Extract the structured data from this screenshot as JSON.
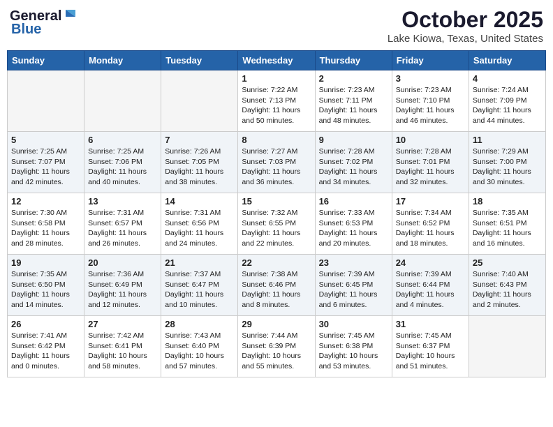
{
  "header": {
    "logo_general": "General",
    "logo_blue": "Blue",
    "month_title": "October 2025",
    "location": "Lake Kiowa, Texas, United States"
  },
  "days_of_week": [
    "Sunday",
    "Monday",
    "Tuesday",
    "Wednesday",
    "Thursday",
    "Friday",
    "Saturday"
  ],
  "weeks": [
    [
      {
        "day": "",
        "info": ""
      },
      {
        "day": "",
        "info": ""
      },
      {
        "day": "",
        "info": ""
      },
      {
        "day": "1",
        "info": "Sunrise: 7:22 AM\nSunset: 7:13 PM\nDaylight: 11 hours\nand 50 minutes."
      },
      {
        "day": "2",
        "info": "Sunrise: 7:23 AM\nSunset: 7:11 PM\nDaylight: 11 hours\nand 48 minutes."
      },
      {
        "day": "3",
        "info": "Sunrise: 7:23 AM\nSunset: 7:10 PM\nDaylight: 11 hours\nand 46 minutes."
      },
      {
        "day": "4",
        "info": "Sunrise: 7:24 AM\nSunset: 7:09 PM\nDaylight: 11 hours\nand 44 minutes."
      }
    ],
    [
      {
        "day": "5",
        "info": "Sunrise: 7:25 AM\nSunset: 7:07 PM\nDaylight: 11 hours\nand 42 minutes."
      },
      {
        "day": "6",
        "info": "Sunrise: 7:25 AM\nSunset: 7:06 PM\nDaylight: 11 hours\nand 40 minutes."
      },
      {
        "day": "7",
        "info": "Sunrise: 7:26 AM\nSunset: 7:05 PM\nDaylight: 11 hours\nand 38 minutes."
      },
      {
        "day": "8",
        "info": "Sunrise: 7:27 AM\nSunset: 7:03 PM\nDaylight: 11 hours\nand 36 minutes."
      },
      {
        "day": "9",
        "info": "Sunrise: 7:28 AM\nSunset: 7:02 PM\nDaylight: 11 hours\nand 34 minutes."
      },
      {
        "day": "10",
        "info": "Sunrise: 7:28 AM\nSunset: 7:01 PM\nDaylight: 11 hours\nand 32 minutes."
      },
      {
        "day": "11",
        "info": "Sunrise: 7:29 AM\nSunset: 7:00 PM\nDaylight: 11 hours\nand 30 minutes."
      }
    ],
    [
      {
        "day": "12",
        "info": "Sunrise: 7:30 AM\nSunset: 6:58 PM\nDaylight: 11 hours\nand 28 minutes."
      },
      {
        "day": "13",
        "info": "Sunrise: 7:31 AM\nSunset: 6:57 PM\nDaylight: 11 hours\nand 26 minutes."
      },
      {
        "day": "14",
        "info": "Sunrise: 7:31 AM\nSunset: 6:56 PM\nDaylight: 11 hours\nand 24 minutes."
      },
      {
        "day": "15",
        "info": "Sunrise: 7:32 AM\nSunset: 6:55 PM\nDaylight: 11 hours\nand 22 minutes."
      },
      {
        "day": "16",
        "info": "Sunrise: 7:33 AM\nSunset: 6:53 PM\nDaylight: 11 hours\nand 20 minutes."
      },
      {
        "day": "17",
        "info": "Sunrise: 7:34 AM\nSunset: 6:52 PM\nDaylight: 11 hours\nand 18 minutes."
      },
      {
        "day": "18",
        "info": "Sunrise: 7:35 AM\nSunset: 6:51 PM\nDaylight: 11 hours\nand 16 minutes."
      }
    ],
    [
      {
        "day": "19",
        "info": "Sunrise: 7:35 AM\nSunset: 6:50 PM\nDaylight: 11 hours\nand 14 minutes."
      },
      {
        "day": "20",
        "info": "Sunrise: 7:36 AM\nSunset: 6:49 PM\nDaylight: 11 hours\nand 12 minutes."
      },
      {
        "day": "21",
        "info": "Sunrise: 7:37 AM\nSunset: 6:47 PM\nDaylight: 11 hours\nand 10 minutes."
      },
      {
        "day": "22",
        "info": "Sunrise: 7:38 AM\nSunset: 6:46 PM\nDaylight: 11 hours\nand 8 minutes."
      },
      {
        "day": "23",
        "info": "Sunrise: 7:39 AM\nSunset: 6:45 PM\nDaylight: 11 hours\nand 6 minutes."
      },
      {
        "day": "24",
        "info": "Sunrise: 7:39 AM\nSunset: 6:44 PM\nDaylight: 11 hours\nand 4 minutes."
      },
      {
        "day": "25",
        "info": "Sunrise: 7:40 AM\nSunset: 6:43 PM\nDaylight: 11 hours\nand 2 minutes."
      }
    ],
    [
      {
        "day": "26",
        "info": "Sunrise: 7:41 AM\nSunset: 6:42 PM\nDaylight: 11 hours\nand 0 minutes."
      },
      {
        "day": "27",
        "info": "Sunrise: 7:42 AM\nSunset: 6:41 PM\nDaylight: 10 hours\nand 58 minutes."
      },
      {
        "day": "28",
        "info": "Sunrise: 7:43 AM\nSunset: 6:40 PM\nDaylight: 10 hours\nand 57 minutes."
      },
      {
        "day": "29",
        "info": "Sunrise: 7:44 AM\nSunset: 6:39 PM\nDaylight: 10 hours\nand 55 minutes."
      },
      {
        "day": "30",
        "info": "Sunrise: 7:45 AM\nSunset: 6:38 PM\nDaylight: 10 hours\nand 53 minutes."
      },
      {
        "day": "31",
        "info": "Sunrise: 7:45 AM\nSunset: 6:37 PM\nDaylight: 10 hours\nand 51 minutes."
      },
      {
        "day": "",
        "info": ""
      }
    ]
  ]
}
